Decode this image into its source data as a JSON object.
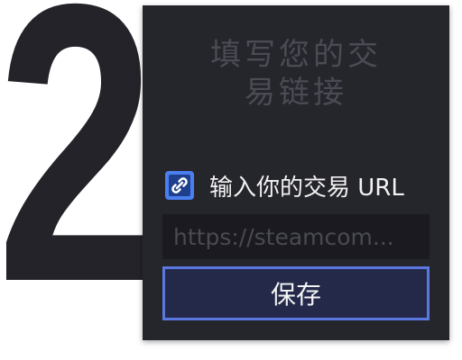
{
  "step": {
    "number": "2"
  },
  "panel": {
    "title_line1": "填写您的交",
    "title_line2": "易链接"
  },
  "trade_url": {
    "icon": "link-icon",
    "label": "输入你的交易 URL",
    "input_value": "",
    "placeholder": "https://steamcom..."
  },
  "actions": {
    "save_label": "保存"
  },
  "colors": {
    "digit": "#232329",
    "panel_bg": "#25252c",
    "title": "#4b4b55",
    "accent": "#5a78e0",
    "button_bg": "#24294a",
    "icon_bg": "#4a7ff0"
  }
}
